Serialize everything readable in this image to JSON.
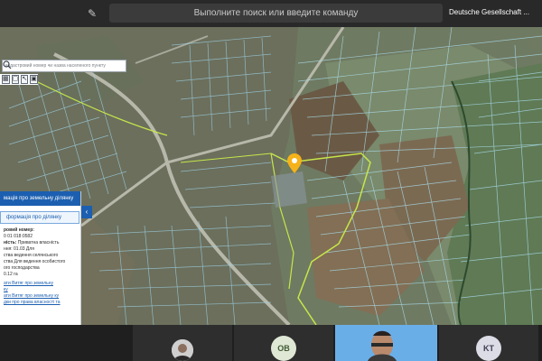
{
  "topbar": {
    "edit_icon": "✎",
    "command_placeholder": "Выполните поиск или введите команду",
    "org_name": "Deutsche Gesellschaft ..."
  },
  "map": {
    "search_placeholder": "кадастровий номер чи назва населеного пункту",
    "tools": [
      "▦",
      "▢",
      "↖",
      "▣"
    ],
    "marker_color": "#f5b21a",
    "parcel_outline_color": "#9fd2e6",
    "boundary_color": "#c6e64a"
  },
  "info_panel": {
    "header": "мація про земельну ділянку",
    "tab": "формація про ділянку",
    "lines": [
      {
        "label": "ровий номер:",
        "value": ""
      },
      {
        "label": "",
        "value": "0 01 018:0582"
      },
      {
        "label": "ність:",
        "value": "Приватна власність"
      },
      {
        "label": "",
        "value": "ння: 01.03 Для"
      },
      {
        "label": "",
        "value": "ства ведення селянського"
      },
      {
        "label": "",
        "value": "ства Для ведення особистого"
      },
      {
        "label": "",
        "value": "ого господарства"
      },
      {
        "label": "",
        "value": "0.12 га"
      }
    ],
    "links": [
      "ати Витяг про земельну",
      "ку",
      "ати Витяг про земельну ку",
      "дки про права власності та"
    ],
    "collapse_icon": "‹"
  },
  "participants": [
    {
      "initials": "",
      "type": "photo"
    },
    {
      "initials": "OB",
      "type": "initials",
      "color": "#dfe8d5",
      "text_color": "#3f5a33"
    },
    {
      "initials": "",
      "type": "video"
    },
    {
      "initials": "KT",
      "type": "initials",
      "color": "#dcdce6",
      "text_color": "#3e3e55"
    }
  ]
}
